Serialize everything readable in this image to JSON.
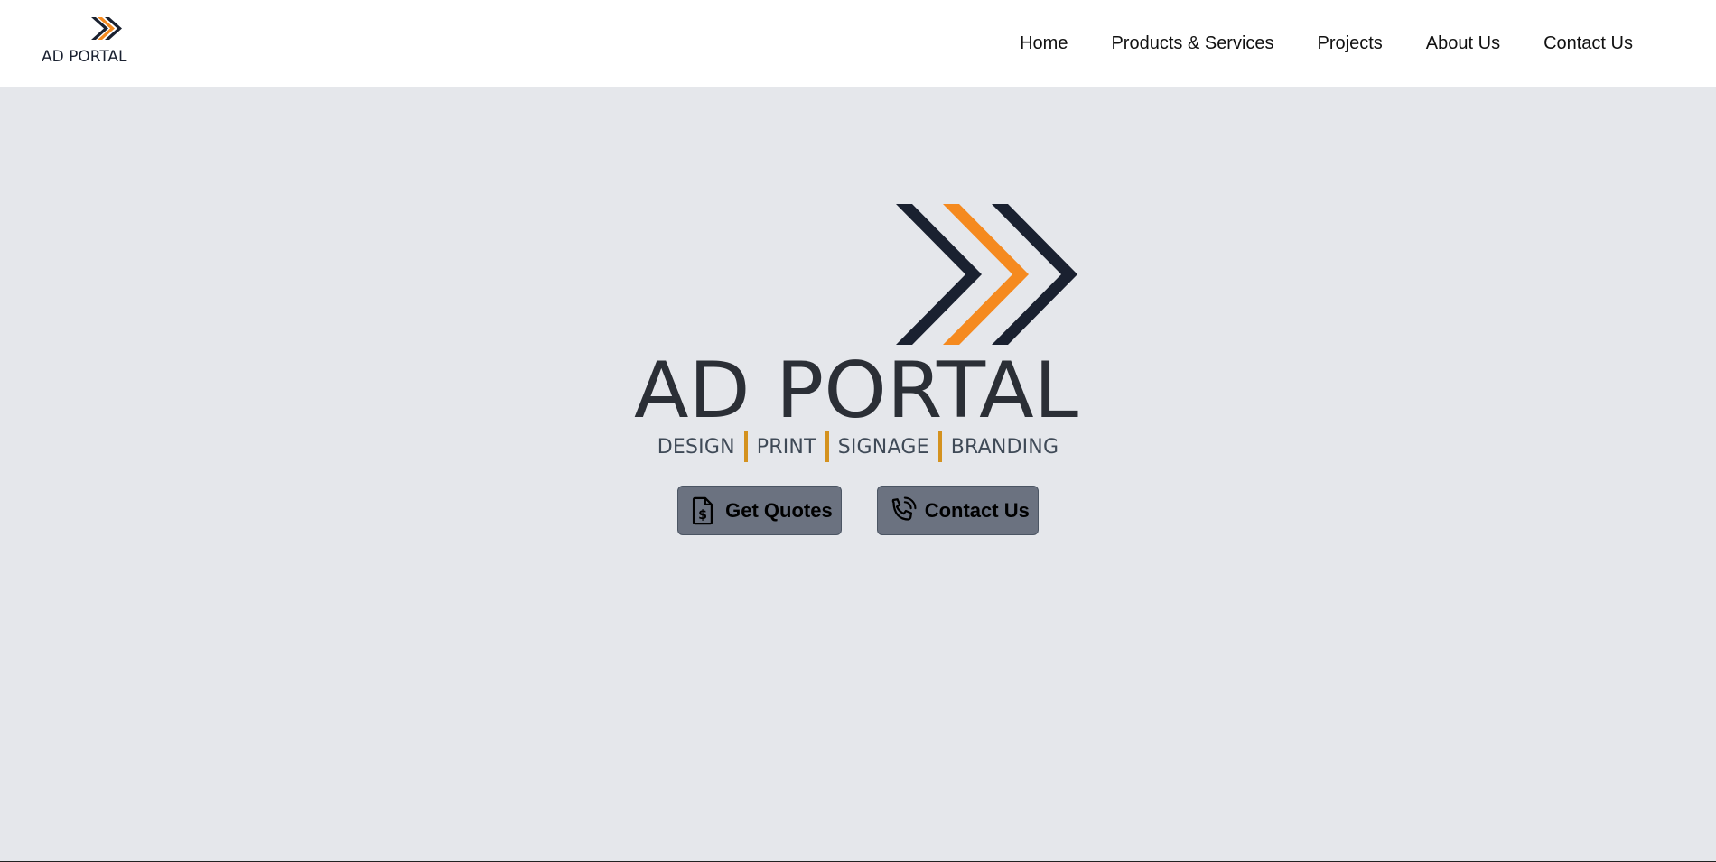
{
  "brand": {
    "logo_icon": "ad-portal-chevrons-logo",
    "logo_text": "AD PORTAL",
    "colors": {
      "navy": "#1a2130",
      "orange": "#f58a1f",
      "wordmark": "#2b2f36",
      "separator": "#d4921f",
      "button": "#6b7280",
      "background": "#e5e7eb"
    }
  },
  "nav": {
    "items": [
      {
        "label": "Home"
      },
      {
        "label": "Products & Services"
      },
      {
        "label": "Projects"
      },
      {
        "label": "About Us"
      },
      {
        "label": "Contact Us"
      }
    ]
  },
  "hero": {
    "tagline": [
      "DESIGN",
      "PRINT",
      "SIGNAGE",
      "BRANDING"
    ],
    "buttons": [
      {
        "label": "Get Quotes",
        "icon": "quote-document-icon"
      },
      {
        "label": "Contact Us",
        "icon": "phone-icon"
      }
    ]
  }
}
